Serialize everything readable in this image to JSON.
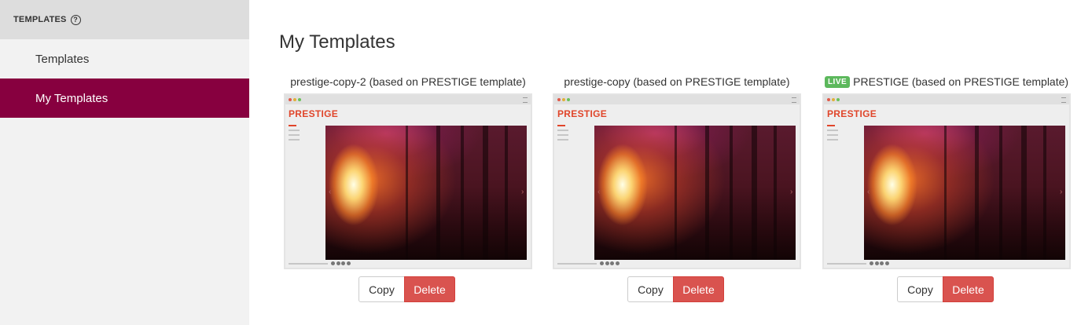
{
  "sidebar": {
    "header_label": "TEMPLATES",
    "help_icon": "question-circle-icon",
    "items": [
      {
        "label": "Templates",
        "active": false
      },
      {
        "label": "My Templates",
        "active": true
      }
    ],
    "active_color": "#87003f"
  },
  "main": {
    "title": "My Templates",
    "cards": [
      {
        "title": "prestige-copy-2 (based on PRESTIGE template)",
        "live": false,
        "thumb_logo": "PRESTIGE",
        "copy_label": "Copy",
        "delete_label": "Delete"
      },
      {
        "title": "prestige-copy (based on PRESTIGE template)",
        "live": false,
        "thumb_logo": "PRESTIGE",
        "copy_label": "Copy",
        "delete_label": "Delete"
      },
      {
        "title": "PRESTIGE (based on PRESTIGE template)",
        "live": true,
        "live_label": "LIVE",
        "thumb_logo": "PRESTIGE",
        "copy_label": "Copy",
        "delete_label": "Delete"
      }
    ]
  },
  "colors": {
    "live_badge": "#5cb85c",
    "delete_button": "#d9534f",
    "thumb_logo": "#e0452a"
  }
}
